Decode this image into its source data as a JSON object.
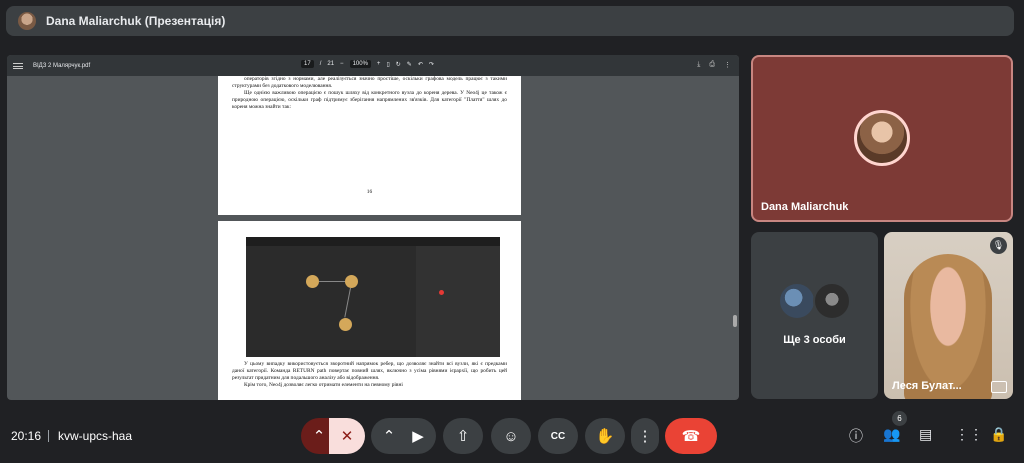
{
  "meeting": {
    "title": "Dana Maliarchuk (Презентація)",
    "time": "20:16",
    "code": "kvw-upcs-haa"
  },
  "pdf": {
    "filename": "ВІДЗ 2 Малярчук.pdf",
    "page_current": "17",
    "page_total": "21",
    "zoom": "100%",
    "page1_lines": [
      "операторів згідно з нормами, але реалізується значно простіше, оскільки графова модель працює з такими структурами без додаткового моделювання.",
      "Ще однією важливою операцією є пошук шляху від конкретного вузла до кореня дерева. У Neo4j це також є природною операцією, оскільки граф підтримує зберігання напрямлених зв'язків. Для категорії \"Плаття\" шлях до кореня можна знайти так:"
    ],
    "page1_number": "16",
    "page2_lines": [
      "У цьому випадку використовується зворотний напрямок ребер, що дозволяє знайти всі вузли, які є предками даної категорії. Команда RETURN path повертає повний шлях, включно з усіма рівнями ієрархії, що робить цей результат придатним для подальшого аналізу або відображення.",
      "Крім того, Neo4j дозволяє легко отримати елементи на певному рівні"
    ]
  },
  "tiles": {
    "presenter_name": "Dana Maliarchuk",
    "others_label": "Ще 3 особи",
    "camera_name": "Леся Булат..."
  },
  "controls": {
    "participants_count": "6"
  }
}
